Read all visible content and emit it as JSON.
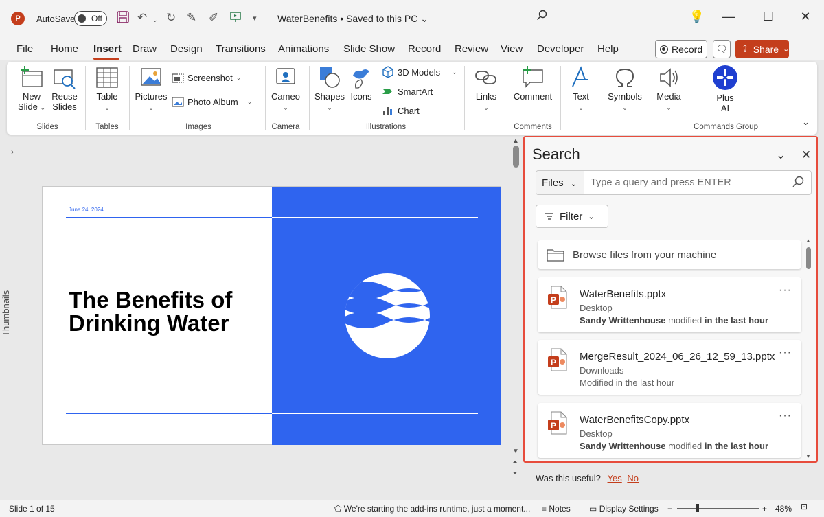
{
  "titlebar": {
    "logo_letter": "P",
    "autosave_label": "AutoSave",
    "autosave_state": "Off",
    "doc_title": "WaterBenefits • Saved to this PC"
  },
  "menu": {
    "items": [
      "File",
      "Home",
      "Insert",
      "Draw",
      "Design",
      "Transitions",
      "Animations",
      "Slide Show",
      "Record",
      "Review",
      "View",
      "Developer",
      "Help"
    ],
    "active": "Insert",
    "record_label": "Record",
    "share_label": "Share"
  },
  "ribbon": {
    "new_slide": "New Slide",
    "new_slide_line1": "New",
    "new_slide_line2": "Slide",
    "reuse_line1": "Reuse",
    "reuse_line2": "Slides",
    "table": "Table",
    "pictures": "Pictures",
    "screenshot": "Screenshot",
    "photo_album": "Photo Album",
    "cameo": "Cameo",
    "shapes": "Shapes",
    "icons": "Icons",
    "models_3d": "3D Models",
    "smartart": "SmartArt",
    "chart": "Chart",
    "links": "Links",
    "comment": "Comment",
    "text": "Text",
    "symbols": "Symbols",
    "media": "Media",
    "plus_ai_line1": "Plus",
    "plus_ai_line2": "AI",
    "groups": {
      "slides": "Slides",
      "tables": "Tables",
      "images": "Images",
      "camera": "Camera",
      "illustrations": "Illustrations",
      "comments": "Comments",
      "commands": "Commands Group"
    }
  },
  "thumbnails_label": "Thumbnails",
  "slide": {
    "date": "June 24, 2024",
    "title_line1": "The Benefits of",
    "title_line2": "Drinking Water",
    "accent_color": "#2f64ef"
  },
  "search_pane": {
    "title": "Search",
    "scope": "Files",
    "query_placeholder": "Type a query and press ENTER",
    "filter_label": "Filter",
    "browse_label": "Browse files from your machine",
    "results": [
      {
        "name": "WaterBenefits.pptx",
        "location": "Desktop",
        "mod_user": "Sandy Writtenhouse",
        "mod_mid": " modified ",
        "mod_when": "in the last hour"
      },
      {
        "name": "MergeResult_2024_06_26_12_59_13.pptx",
        "location": "Downloads",
        "mod_user": "",
        "mod_mid": "Modified in the last hour",
        "mod_when": ""
      },
      {
        "name": "WaterBenefitsCopy.pptx",
        "location": "Desktop",
        "mod_user": "Sandy Writtenhouse",
        "mod_mid": " modified ",
        "mod_when": "in the last hour"
      }
    ],
    "useful_q": "Was this useful?",
    "useful_yes": "Yes",
    "useful_no": "No"
  },
  "statusbar": {
    "slide_pos": "Slide 1 of 15",
    "runtime_msg": "We're starting the add-ins runtime, just a moment...",
    "notes": "Notes",
    "display_settings": "Display Settings",
    "zoom": "48%"
  },
  "colors": {
    "brand": "#c43e1c",
    "highlight_border": "#e74c3c"
  }
}
